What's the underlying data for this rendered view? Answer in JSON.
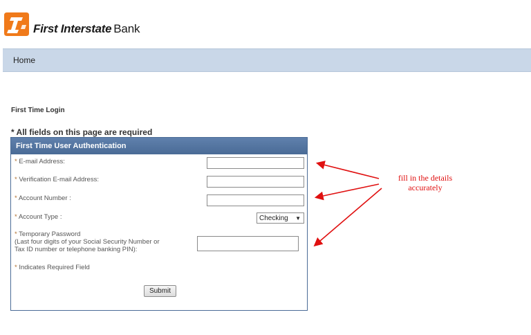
{
  "brand": {
    "name_bold": "First Interstate",
    "name_regular": "Bank",
    "logo_colors": {
      "orange": "#f07a1a",
      "white": "#ffffff"
    }
  },
  "nav": {
    "home_label": "Home"
  },
  "page": {
    "title": "First Time Login",
    "required_note": "* All fields on this page are required"
  },
  "form": {
    "header": "First Time User Authentication",
    "fields": {
      "email": {
        "label": "E-mail Address:",
        "value": ""
      },
      "verify_email": {
        "label": "Verification E-mail Address:",
        "value": ""
      },
      "account_number": {
        "label": "Account Number :",
        "value": ""
      },
      "account_type": {
        "label": "Account Type :",
        "selected": "Checking"
      },
      "temp_password": {
        "label": "Temporary Password",
        "hint_line1": "(Last four digits of your Social Security Number or",
        "hint_line2": "Tax ID number or telephone banking PIN):",
        "value": ""
      }
    },
    "required_legend": "Indicates Required Field",
    "submit_label": "Submit"
  },
  "annotation": {
    "line1": "fill in the details",
    "line2": "accurately",
    "color": "#e01010"
  },
  "colors": {
    "nav_bg": "#c9d7e8",
    "panel_header": "#4a6b96"
  }
}
